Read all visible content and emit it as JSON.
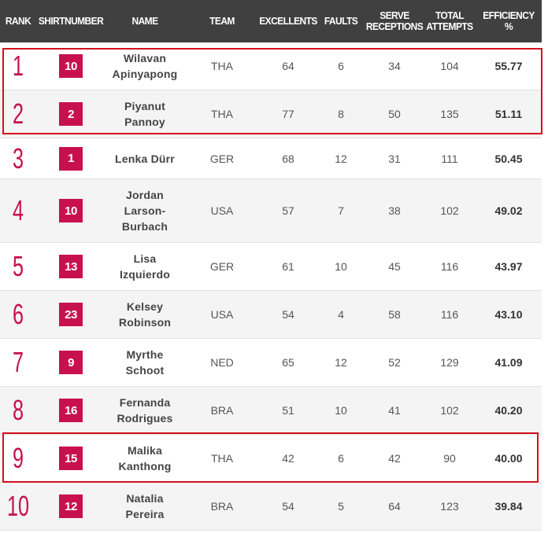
{
  "headers": {
    "rank": "RANK",
    "shirt": "SHIRTNUMBER",
    "name": "NAME",
    "team": "TEAM",
    "excellents": "EXCELLENTS",
    "faults": "FAULTS",
    "serve_1": "SERVE",
    "serve_2": "RECEPTIONS",
    "total_1": "TOTAL",
    "total_2": "ATTEMPTS",
    "eff_1": "EFFICIENCY",
    "eff_2": "%"
  },
  "rows": [
    {
      "rank": "1",
      "shirt": "10",
      "name": [
        "Wilavan",
        "Apinyapong"
      ],
      "team": "THA",
      "excellents": "64",
      "faults": "6",
      "serve": "34",
      "total": "104",
      "eff": "55.77"
    },
    {
      "rank": "2",
      "shirt": "2",
      "name": [
        "Piyanut",
        "Pannoy"
      ],
      "team": "THA",
      "excellents": "77",
      "faults": "8",
      "serve": "50",
      "total": "135",
      "eff": "51.11"
    },
    {
      "rank": "3",
      "shirt": "1",
      "name": [
        "Lenka Dürr"
      ],
      "team": "GER",
      "excellents": "68",
      "faults": "12",
      "serve": "31",
      "total": "111",
      "eff": "50.45"
    },
    {
      "rank": "4",
      "shirt": "10",
      "name": [
        "Jordan",
        "Larson-",
        "Burbach"
      ],
      "team": "USA",
      "excellents": "57",
      "faults": "7",
      "serve": "38",
      "total": "102",
      "eff": "49.02"
    },
    {
      "rank": "5",
      "shirt": "13",
      "name": [
        "Lisa",
        "Izquierdo"
      ],
      "team": "GER",
      "excellents": "61",
      "faults": "10",
      "serve": "45",
      "total": "116",
      "eff": "43.97"
    },
    {
      "rank": "6",
      "shirt": "23",
      "name": [
        "Kelsey",
        "Robinson"
      ],
      "team": "USA",
      "excellents": "54",
      "faults": "4",
      "serve": "58",
      "total": "116",
      "eff": "43.10"
    },
    {
      "rank": "7",
      "shirt": "9",
      "name": [
        "Myrthe",
        "Schoot"
      ],
      "team": "NED",
      "excellents": "65",
      "faults": "12",
      "serve": "52",
      "total": "129",
      "eff": "41.09"
    },
    {
      "rank": "8",
      "shirt": "16",
      "name": [
        "Fernanda",
        "Rodrigues"
      ],
      "team": "BRA",
      "excellents": "51",
      "faults": "10",
      "serve": "41",
      "total": "102",
      "eff": "40.20"
    },
    {
      "rank": "9",
      "shirt": "15",
      "name": [
        "Malika",
        "Kanthong"
      ],
      "team": "THA",
      "excellents": "42",
      "faults": "6",
      "serve": "42",
      "total": "90",
      "eff": "40.00"
    },
    {
      "rank": "10",
      "shirt": "12",
      "name": [
        "Natalia",
        "Pereira"
      ],
      "team": "BRA",
      "excellents": "54",
      "faults": "5",
      "serve": "64",
      "total": "123",
      "eff": "39.84"
    }
  ],
  "colors": {
    "accent": "#c8104e",
    "header_bg": "#404040",
    "highlight_border": "#d40f1d"
  }
}
